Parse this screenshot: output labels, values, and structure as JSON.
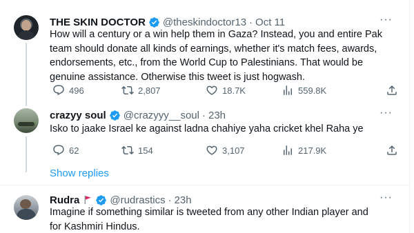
{
  "tweets": [
    {
      "name": "THE SKIN DOCTOR",
      "handle": "@theskindoctor13",
      "time": "Oct 11",
      "text_lines": [
        "How will a century or a win help them in Gaza? Instead, you and entire Pak",
        "team should donate all kinds of earnings, whether it's match fees, awards,",
        "endorsements, etc., from the World Cup to Palestinians. That would be",
        "genuine assistance. Otherwise this tweet is just hogwash."
      ],
      "replies": "496",
      "retweets": "2,807",
      "likes": "18.7K",
      "views": "559.8K"
    },
    {
      "name": "crazyy soul",
      "handle": "@crazyyy__soul",
      "time": "23h",
      "text_lines": [
        "Isko to jaake Israel ke against ladna chahiye yaha cricket khel Raha ye"
      ],
      "replies": "62",
      "retweets": "154",
      "likes": "3,107",
      "views": "217.9K"
    },
    {
      "name": "Rudra",
      "handle": "@rudrastics",
      "time": "23h",
      "text_lines": [
        "Imagine if something similar is tweeted from any other Indian player and",
        "for Kashmiri Hindus."
      ]
    }
  ],
  "show_replies": "Show replies",
  "dot": "·",
  "colors": {
    "verified": "#1d9bf0",
    "text": "#0f1419",
    "secondary": "#536471",
    "link": "#1d9bf0",
    "flag": "#e0245e"
  },
  "icons": [
    "verified-badge-icon",
    "more-icon",
    "reply-icon",
    "retweet-icon",
    "like-icon",
    "views-icon",
    "share-icon",
    "red-flag-icon"
  ]
}
